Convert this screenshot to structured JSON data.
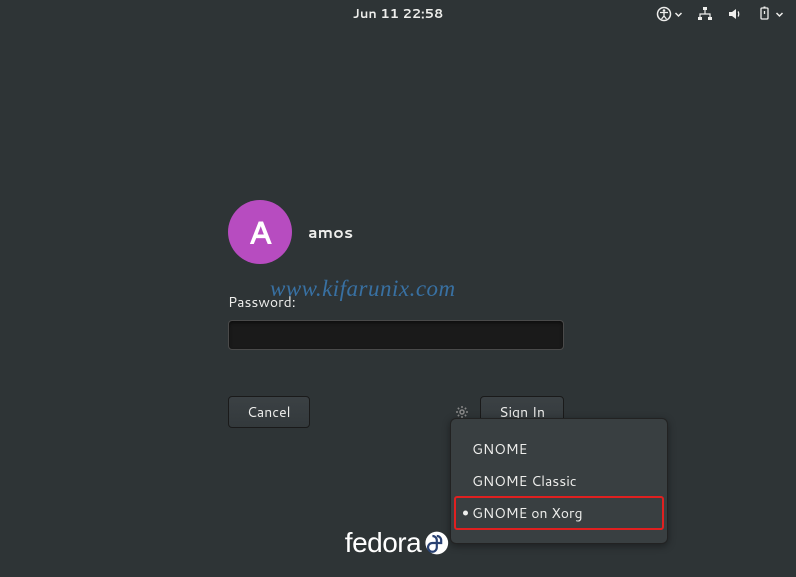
{
  "topbar": {
    "datetime": "Jun 11  22:58"
  },
  "login": {
    "avatar_initial": "A",
    "username": "amos",
    "password_label": "Password:",
    "password_value": "",
    "cancel_label": "Cancel",
    "signin_label": "Sign In"
  },
  "session_menu": {
    "items": [
      {
        "label": "GNOME",
        "selected": false
      },
      {
        "label": "GNOME Classic",
        "selected": false
      },
      {
        "label": "GNOME on Xorg",
        "selected": true
      }
    ]
  },
  "branding": {
    "distro": "fedora"
  },
  "watermark": "www.kifarunix.com"
}
